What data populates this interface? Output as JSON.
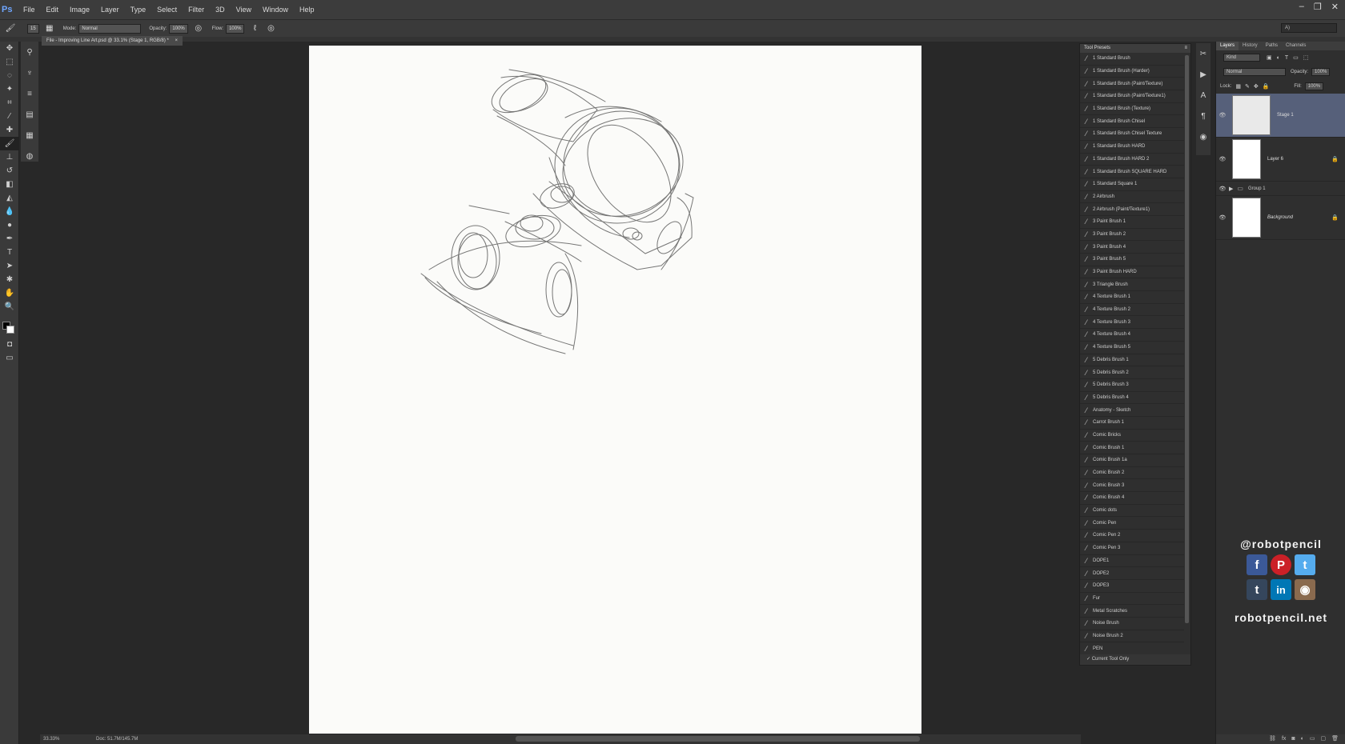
{
  "app": {
    "logo": "Ps"
  },
  "menu": [
    "File",
    "Edit",
    "Image",
    "Layer",
    "Type",
    "Select",
    "Filter",
    "3D",
    "View",
    "Window",
    "Help"
  ],
  "window_controls": [
    "–",
    "❐",
    "✕"
  ],
  "options": {
    "brush_size": "15",
    "mode_label": "Mode:",
    "mode_value": "Normal",
    "opacity_label": "Opacity:",
    "opacity_value": "100%",
    "flow_label": "Flow:",
    "flow_value": "100%",
    "workspace": "A)"
  },
  "document": {
    "tab_title": "File - Improving Line Art.psd @ 33.1% (Stage 1, RGB/8) *",
    "close": "×"
  },
  "status": {
    "zoom": "33.33%",
    "doc": "Doc: 51.7M/145.7M"
  },
  "tool_presets": {
    "title": "Tool Presets",
    "footer_label": "Current Tool Only",
    "items": [
      "1 Standard Brush",
      "1 Standard Brush (Harder)",
      "1 Standard Brush (Paint/Texture)",
      "1 Standard Brush (Paint/Texture1)",
      "1 Standard Brush (Texture)",
      "1 Standard Brush Chisel",
      "1 Standard Brush Chisel Texture",
      "1 Standard Brush HARD",
      "1 Standard Brush HARD 2",
      "1 Standard Brush SQUARE HARD",
      "1 Standard Square 1",
      "2 Airbrush",
      "2 Airbrush (Paint/Texture1)",
      "3 Paint Brush 1",
      "3 Paint Brush 2",
      "3 Paint Brush 4",
      "3 Paint Brush 5",
      "3 Paint Brush HARD",
      "3 Triangle Brush",
      "4 Texture Brush 1",
      "4 Texture Brush 2",
      "4 Texture Brush 3",
      "4 Texture Brush 4",
      "4 Texture Brush 5",
      "5 Debris Brush 1",
      "5 Debris Brush 2",
      "5 Debris Brush 3",
      "5 Debris Brush 4",
      "Anatomy - Sketch",
      "Carrot Brush 1",
      "Comic Bricks",
      "Comic Brush 1",
      "Comic Brush 1a",
      "Comic Brush 2",
      "Comic Brush 3",
      "Comic Brush 4",
      "Comic dots",
      "Comic Pen",
      "Comic Pen 2",
      "Comic Pen 3",
      "DOPE1",
      "DOPE2",
      "DOPE3",
      "Fur",
      "Metal Scratches",
      "Noise Brush",
      "Noise Brush 2",
      "PEN"
    ]
  },
  "layers_panel": {
    "tabs": [
      "Layers",
      "History",
      "Paths",
      "Channels"
    ],
    "kind_label": "Kind",
    "blend_mode": "Normal",
    "opacity_label": "Opacity:",
    "opacity_value": "100%",
    "lock_label": "Lock:",
    "fill_label": "Fill:",
    "fill_value": "100%",
    "layers": [
      {
        "name": "Stage 1"
      },
      {
        "name": "Layer 6"
      },
      {
        "name": "Group 1"
      },
      {
        "name": "Background"
      }
    ]
  },
  "social": {
    "handle": "@robotpencil",
    "icons": [
      {
        "name": "facebook",
        "glyph": "f",
        "color": "#3b5998"
      },
      {
        "name": "pinterest",
        "glyph": "P",
        "color": "#cb2027"
      },
      {
        "name": "twitter",
        "glyph": "t",
        "color": "#55acee"
      },
      {
        "name": "tumblr",
        "glyph": "t",
        "color": "#35465c"
      },
      {
        "name": "linkedin",
        "glyph": "in",
        "color": "#0077b5"
      },
      {
        "name": "instagram",
        "glyph": "◉",
        "color": "#8a6a4e"
      }
    ],
    "site": "robotpencil.net"
  }
}
